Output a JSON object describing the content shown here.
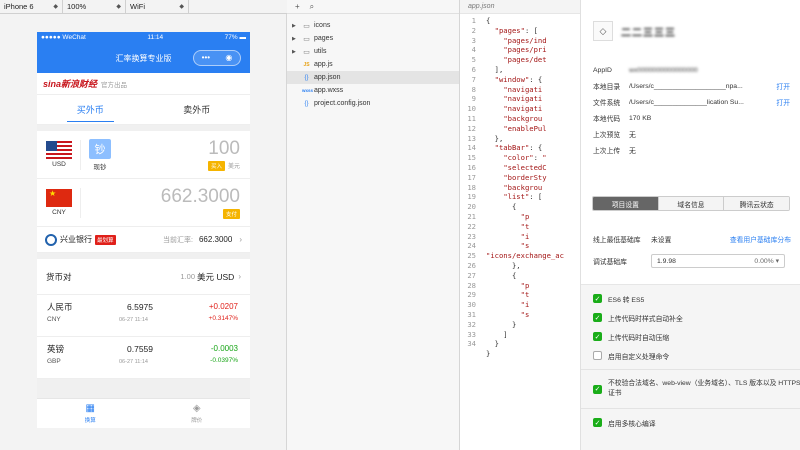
{
  "toolbar": {
    "device": "iPhone 6",
    "zoom": "100%",
    "network": "WiFi"
  },
  "phone": {
    "status": {
      "carrier": "●●●●● WeChat",
      "wifi": "⌔",
      "time": "11:14",
      "battery": "77% ▬"
    },
    "nav_title": "汇率换算专业版",
    "capsule": {
      "more": "•••",
      "close": "◉"
    },
    "brand": {
      "logo": "sina新浪财经",
      "sub": "官方出品"
    },
    "tabs": [
      {
        "label": "买外币"
      },
      {
        "label": "卖外币"
      }
    ],
    "from": {
      "code": "USD",
      "cash_label": "现钞",
      "amount": "100",
      "tag": "买入",
      "unit": "美元"
    },
    "to": {
      "code": "CNY",
      "amount": "662.3000",
      "tag": "支付"
    },
    "bank": {
      "name": "兴业银行",
      "badge": "最划算",
      "rate_label": "当前汇率:",
      "rate": "662.3000"
    },
    "pair": {
      "label": "货币对",
      "one": "1.00",
      "unit": "美元 USD"
    },
    "rows": [
      {
        "name": "人民币",
        "code": "CNY",
        "rate": "6.5975",
        "time": "06-27 11:14",
        "change": "+0.0207",
        "pct": "+0.3147%",
        "dir": "up"
      },
      {
        "name": "英镑",
        "code": "GBP",
        "rate": "0.7559",
        "time": "06-27 11:14",
        "change": "-0.0003",
        "pct": "-0.0397%",
        "dir": "down"
      }
    ],
    "tabbar": [
      {
        "label": "换算",
        "icon": "calculator-icon"
      },
      {
        "label": "牌价",
        "icon": "stack-icon"
      }
    ]
  },
  "tree": {
    "items": [
      {
        "label": "icons",
        "type": "folder"
      },
      {
        "label": "pages",
        "type": "folder"
      },
      {
        "label": "utils",
        "type": "folder"
      },
      {
        "label": "app.js",
        "type": "js"
      },
      {
        "label": "app.json",
        "type": "json"
      },
      {
        "label": "app.wxss",
        "type": "wxss"
      },
      {
        "label": "project.config.json",
        "type": "json"
      }
    ]
  },
  "editor": {
    "tab": "app.json",
    "lines": [
      "{",
      "  \"pages\": [",
      "    \"pages/ind",
      "    \"pages/pri",
      "    \"pages/det",
      "  ],",
      "  \"window\": {",
      "    \"navigati",
      "    \"navigati",
      "    \"navigati",
      "    \"backgrou",
      "    \"enablePul",
      "  },",
      "  \"tabBar\": {",
      "    \"color\": \"",
      "    \"selectedC",
      "    \"borderSty",
      "    \"backgrou",
      "    \"list\": [",
      "      {",
      "        \"p",
      "        \"t",
      "        \"i",
      "        \"s",
      "\"icons/exchange_ac",
      "      },",
      "      {",
      "        \"p",
      "        \"t",
      "        \"i",
      "        \"s",
      "      }",
      "    ]",
      "  }",
      "}"
    ],
    "line_numbers": [
      "1",
      "2",
      "3",
      "4",
      "5",
      "6",
      "7",
      "8",
      "9",
      "10",
      "11",
      "12",
      "13",
      "14",
      "15",
      "16",
      "17",
      "18",
      "19",
      "20",
      "21",
      "22",
      "23",
      "24",
      "25",
      "26",
      "27",
      "28",
      "29",
      "30",
      "31",
      "32",
      "33",
      "34"
    ]
  },
  "details": {
    "project_name": "二二三三三",
    "fields": [
      {
        "key": "AppID",
        "value": "wx0000000000000000",
        "link": ""
      },
      {
        "key": "本地目录",
        "value": "/Users/c___________________npa...",
        "link": "打开"
      },
      {
        "key": "文件系统",
        "value": "/Users/c______________lication Su...",
        "link": "打开"
      },
      {
        "key": "本地代码",
        "value": "170 KB",
        "link": ""
      },
      {
        "key": "上次预览",
        "value": "无",
        "link": ""
      },
      {
        "key": "上次上传",
        "value": "无",
        "link": ""
      }
    ],
    "segments": [
      "项目设置",
      "域名信息",
      "腾讯云状态"
    ],
    "lib_min_label": "线上最低基础库",
    "lib_min_value": "未设置",
    "lib_min_link": "查看用户基础库分布",
    "lib_debug_label": "调试基础库",
    "lib_debug_value": "1.9.98",
    "lib_debug_pct": "0.00% ▾",
    "checks": [
      {
        "label": "ES6 转 ES5",
        "on": true
      },
      {
        "label": "上传代码时样式自动补全",
        "on": true
      },
      {
        "label": "上传代码时自动压缩",
        "on": true
      },
      {
        "label": "启用自定义处理命令",
        "on": false
      },
      {
        "label": "不校验合法域名、web-view（业务域名）、TLS 版本以及 HTTPS 证书",
        "on": true
      },
      {
        "label": "启用多核心编译",
        "on": true
      }
    ]
  }
}
